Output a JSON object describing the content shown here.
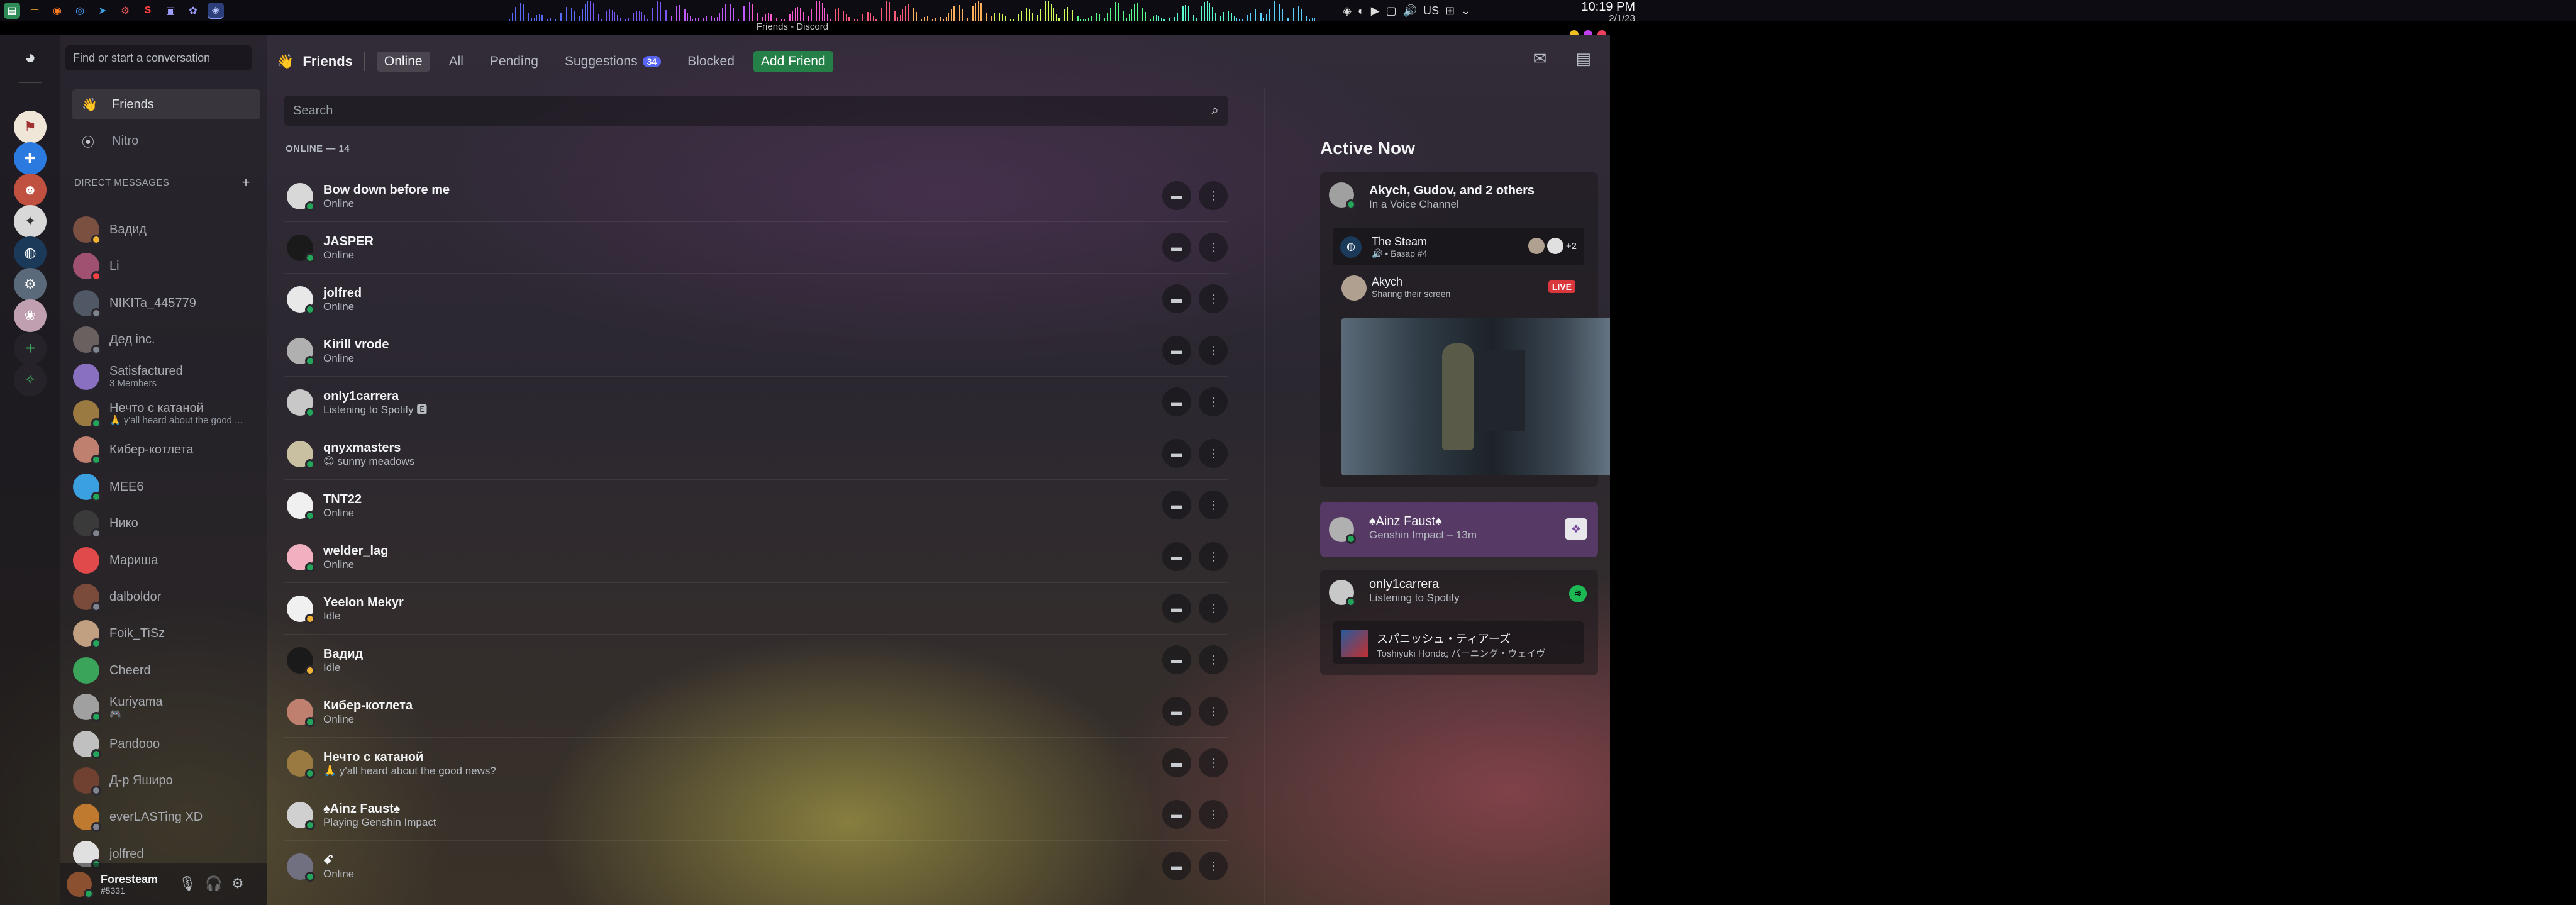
{
  "taskbar": {
    "clock_time": "10:19 PM",
    "clock_date": "2/1/23",
    "keyboard_layout": "US"
  },
  "window": {
    "title": "Friends - Discord"
  },
  "dm_sidebar": {
    "search_placeholder": "Find or start a conversation",
    "nav": [
      {
        "label": "Friends",
        "icon": "friends-wave-icon"
      },
      {
        "label": "Nitro",
        "icon": "nitro-icon"
      }
    ],
    "dm_header": "DIRECT MESSAGES",
    "add_dm": "+",
    "dms": [
      {
        "name": "Вадид",
        "sub": "",
        "status": "idle",
        "color": "#7a5040"
      },
      {
        "name": "Li",
        "sub": "",
        "status": "dnd",
        "color": "#a05070"
      },
      {
        "name": "NIKITa_445779",
        "sub": "",
        "status": "offline",
        "color": "#505866"
      },
      {
        "name": "Дед inc.",
        "sub": "",
        "status": "offline",
        "color": "#6a6060"
      },
      {
        "name": "Satisfactured",
        "sub": "3 Members",
        "status": "",
        "color": "#8a70c0"
      },
      {
        "name": "Нечто с катаной",
        "sub": "🙏 y'all heard about the good ...",
        "status": "online",
        "color": "#9a7a40"
      },
      {
        "name": "Кибер-котлета",
        "sub": "",
        "status": "online",
        "color": "#c08070"
      },
      {
        "name": "MEE6",
        "sub": "",
        "status": "online",
        "color": "#3aa0e0"
      },
      {
        "name": "Нико",
        "sub": "",
        "status": "offline",
        "color": "#3a3a3a"
      },
      {
        "name": "Мариша",
        "sub": "",
        "status": "",
        "color": "#e04a4a"
      },
      {
        "name": "dalboldor",
        "sub": "",
        "status": "offline",
        "color": "#7a4a3a"
      },
      {
        "name": "Foik_TiSz",
        "sub": "",
        "status": "online",
        "color": "#c0a080"
      },
      {
        "name": "Cheerd",
        "sub": "",
        "status": "",
        "color": "#3aa55a"
      },
      {
        "name": "Kuriyama",
        "sub": "🎮",
        "status": "online",
        "color": "#a0a0a0"
      },
      {
        "name": "Pandooo",
        "sub": "",
        "status": "online",
        "color": "#c0c0c0"
      },
      {
        "name": "Д-р Яшиpo",
        "sub": "",
        "status": "offline",
        "color": "#704030"
      },
      {
        "name": "everLASTing XD",
        "sub": "",
        "status": "offline",
        "color": "#c07a30"
      },
      {
        "name": "jolfred",
        "sub": "",
        "status": "online",
        "color": "#e0e0e0"
      }
    ]
  },
  "user_panel": {
    "name": "Foresteam",
    "tag": "#5331"
  },
  "header": {
    "title": "Friends",
    "tabs": [
      "Online",
      "All",
      "Pending",
      "Suggestions",
      "Blocked"
    ],
    "suggestions_count": "34",
    "add_friend": "Add Friend"
  },
  "friends": {
    "search_placeholder": "Search",
    "online_header": "ONLINE — 14",
    "list": [
      {
        "name": "Bow down before me",
        "status_text": "Online",
        "status": "online",
        "color": "#d8d8d8"
      },
      {
        "name": "JASPER",
        "status_text": "Online",
        "status": "online",
        "color": "#1a1a1a"
      },
      {
        "name": "jolfred",
        "status_text": "Online",
        "status": "online",
        "color": "#e8e8e8"
      },
      {
        "name": "Kirill vrode",
        "status_text": "Online",
        "status": "online",
        "color": "#b0b0b0"
      },
      {
        "name": "only1carrera",
        "status_text": "Listening to Spotify 🅴",
        "status": "online",
        "color": "#c8c8c8"
      },
      {
        "name": "qnyxmasters",
        "status_text": "😊 sunny meadows",
        "status": "online",
        "color": "#c8c0a0"
      },
      {
        "name": "TNT22",
        "status_text": "Online",
        "status": "online",
        "color": "#f0f0f0"
      },
      {
        "name": "welder_lag",
        "status_text": "Online",
        "status": "online",
        "color": "#f0b0c0"
      },
      {
        "name": "Yeelon Mekyr",
        "status_text": "Idle",
        "status": "idle",
        "color": "#f0f0f0"
      },
      {
        "name": "Вадид",
        "status_text": "Idle",
        "status": "idle",
        "color": "#1a1a1a"
      },
      {
        "name": "Кибер-котлета",
        "status_text": "Online",
        "status": "online",
        "color": "#c08070"
      },
      {
        "name": "Нечто с катаной",
        "status_text": "🙏 y'all heard about the good news?",
        "status": "online",
        "color": "#9a7a40"
      },
      {
        "name": "♠Ainz Faust♠",
        "status_text": "Playing Genshin Impact",
        "status": "online",
        "color": "#d0d0d0"
      },
      {
        "name": "ꗃ",
        "status_text": "Online",
        "status": "online",
        "color": "#707080"
      }
    ]
  },
  "active_now": {
    "title": "Active Now",
    "voice_card": {
      "title": "Akych, Gudov, and 2 others",
      "sub": "In a Voice Channel",
      "server_name": "The Steam",
      "server_channel": "🔊 • Базар #4",
      "extra": "+2",
      "streamer": "Akych",
      "streamer_sub": "Sharing their screen",
      "live": "LIVE"
    },
    "game_card": {
      "title": "♠Ainz Faust♠",
      "sub": "Genshin Impact – 13m"
    },
    "spotify_card": {
      "title": "only1carrera",
      "sub": "Listening to Spotify",
      "track": "スパニッシュ・ティアーズ",
      "artist": "Toshiyuki Honda; バーニング・ウェイヴ"
    }
  }
}
